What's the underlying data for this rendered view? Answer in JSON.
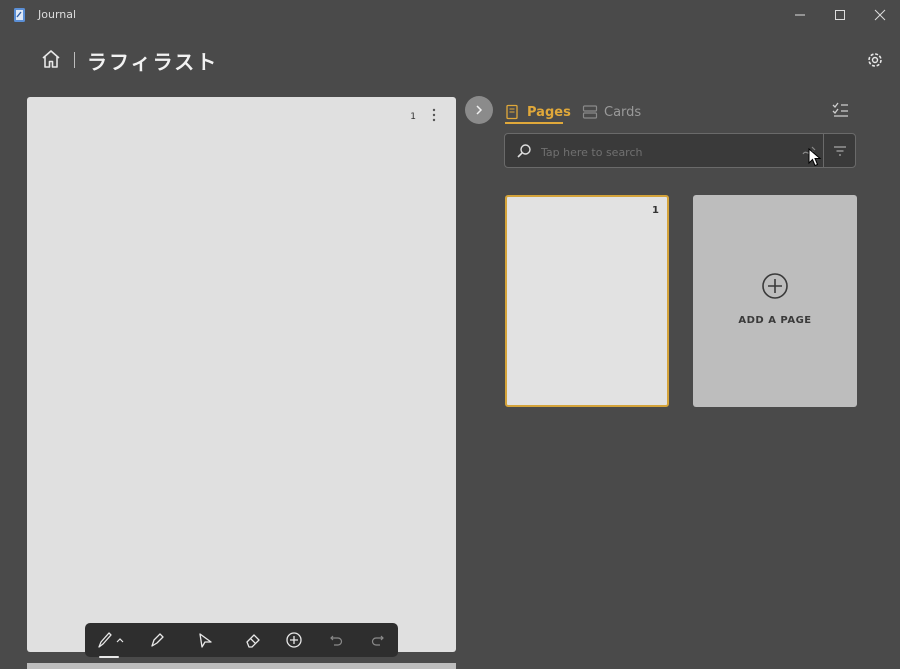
{
  "window": {
    "title": "Journal"
  },
  "header": {
    "notebook_title": "ラフィラスト"
  },
  "canvas": {
    "page_number": "1"
  },
  "panel": {
    "tabs": [
      {
        "label": "Pages",
        "icon": "pages-icon",
        "active": true
      },
      {
        "label": "Cards",
        "icon": "cards-icon",
        "active": false
      }
    ],
    "search": {
      "placeholder": "Tap here to search",
      "value": ""
    },
    "pages": [
      {
        "number": "1",
        "selected": true
      }
    ],
    "add_page_label": "ADD A PAGE"
  },
  "toolbar": {
    "tools": [
      "pen-icon",
      "highlighter-icon",
      "ink-select-icon",
      "eraser-icon",
      "insert-icon",
      "undo-icon",
      "redo-icon"
    ],
    "active_tool": "pen-icon"
  },
  "colors": {
    "background": "#4a4a4a",
    "accent": "#e0a83a",
    "page": "#e0e0e0",
    "toolbar": "#2e2e2e"
  }
}
